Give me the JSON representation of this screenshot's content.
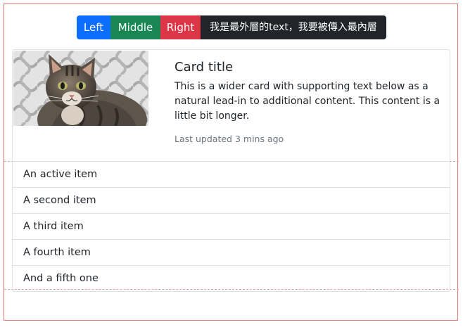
{
  "button_group": {
    "left": "Left",
    "middle": "Middle",
    "right": "Right",
    "dark": "我是最外層的text，我要被傳入最內層"
  },
  "colors": {
    "primary": "#0d6efd",
    "success": "#198754",
    "danger": "#dc3545",
    "dark": "#212529",
    "frame_red": "#e57373",
    "dashed_pink": "#e7a0a6"
  },
  "card": {
    "image": "cat-photo",
    "title": "Card title",
    "text": "This is a wider card with supporting text below as a natural lead-in to additional content. This content is a little bit longer.",
    "muted": "Last updated 3 mins ago"
  },
  "list": {
    "items": [
      "An active item",
      "A second item",
      "A third item",
      "A fourth item",
      "And a fifth one"
    ]
  }
}
